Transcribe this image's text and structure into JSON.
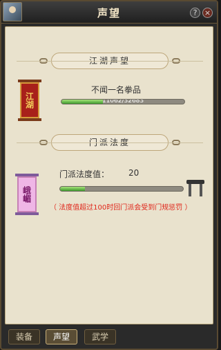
{
  "window": {
    "title": "声望",
    "help_label": "?",
    "close_label": "×"
  },
  "jianghu": {
    "header": "江湖声望",
    "banner_text": "江湖",
    "rank": "不闻一名拳品",
    "progress_text": "11062/32683",
    "progress_fraction": 0.338
  },
  "sect": {
    "header": "门派法度",
    "banner_text": "峨嵋",
    "law_label": "门派法度值：",
    "law_value": "20",
    "progress_fraction": 0.2,
    "warning": "（ 法度值超过100时回门派会受到门规惩罚 ）"
  },
  "tabs": [
    {
      "label": "装备"
    },
    {
      "label": "声望"
    },
    {
      "label": "武学"
    }
  ],
  "colors": {
    "panel_bg": "#e9e2cd",
    "progress_fill": "#5fb83e",
    "warning_text": "#e0261a",
    "title_text": "#f1e4c6"
  }
}
